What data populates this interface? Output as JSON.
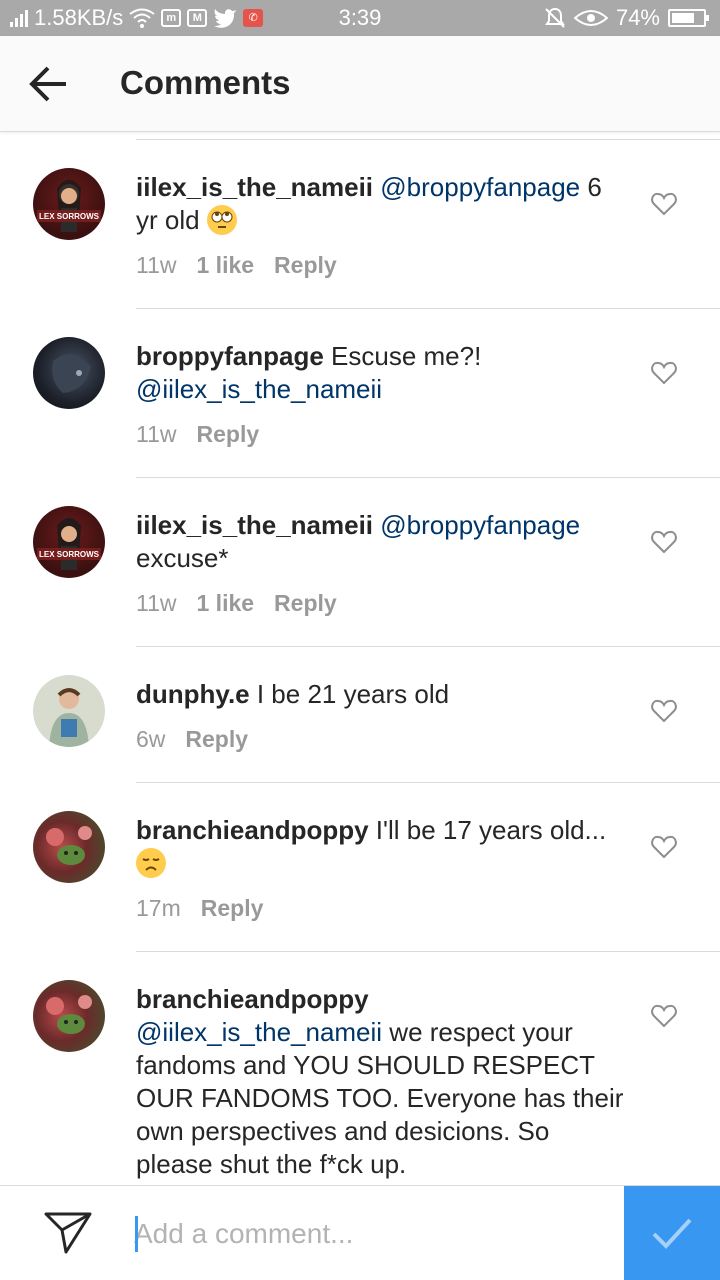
{
  "status_bar": {
    "net_speed": "1.58KB/s",
    "time": "3:39",
    "battery": "74%",
    "battery_level": 0.74,
    "icons": [
      "signal-icon",
      "wifi-icon",
      "notification-icon",
      "gmail-icon",
      "twitter-icon",
      "call-icon",
      "silent-icon",
      "eye-icon",
      "battery-icon"
    ]
  },
  "app_bar": {
    "title": "Comments",
    "back_icon": "arrow-left-icon"
  },
  "comments": [
    {
      "username": "iilex_is_the_nameii",
      "mention": "@broppyfanpage",
      "text": " 6 yr old ",
      "emoji": "eye-roll-emoji",
      "time": "11w",
      "likes": "1 like",
      "reply": "Reply",
      "avatar_label": "LEX SORROWS"
    },
    {
      "username": "broppyfanpage",
      "text": " Escuse me?! ",
      "mention": "@iilex_is_the_nameii",
      "time": "11w",
      "reply": "Reply"
    },
    {
      "username": "iilex_is_the_nameii",
      "mention": "@broppyfanpage",
      "text": " excuse*",
      "time": "11w",
      "likes": "1 like",
      "reply": "Reply",
      "avatar_label": "LEX SORROWS"
    },
    {
      "username": "dunphy.e",
      "text": " I be 21 years old",
      "time": "6w",
      "reply": "Reply"
    },
    {
      "username": "branchieandpoppy",
      "text": " I'll be 17 years old... ",
      "emoji": "disappointed-emoji",
      "time": "17m",
      "reply": "Reply"
    },
    {
      "username": "branchieandpoppy",
      "mention": "@iilex_is_the_nameii",
      "text": " we respect your fandoms and YOU SHOULD RESPECT OUR FANDOMS TOO. Everyone has their own perspectives and desicions. So please shut the f*ck up."
    }
  ],
  "input_bar": {
    "placeholder": "Add a comment...",
    "send_icon": "paper-plane-icon",
    "post_icon": "checkmark-icon"
  },
  "colors": {
    "status_bar": "#a9a9a9",
    "mention": "#003569",
    "meta": "#999999",
    "accent": "#3897f0",
    "divider": "#dbdbdb"
  }
}
